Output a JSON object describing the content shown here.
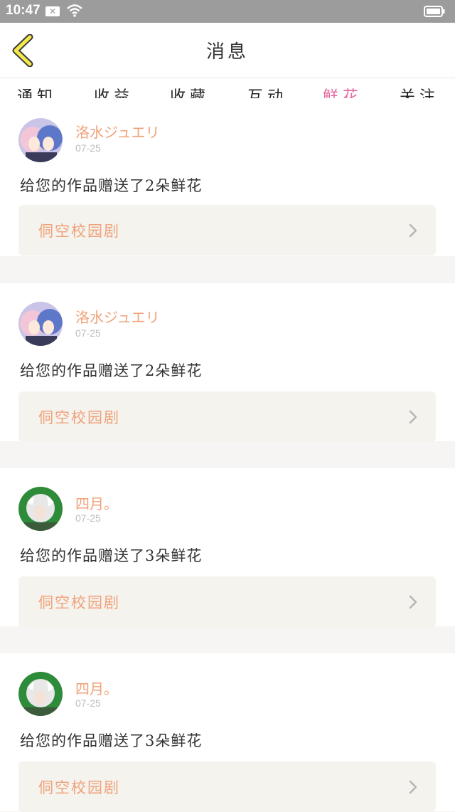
{
  "status_bar": {
    "time": "10:47",
    "icons": [
      "notification-x-icon",
      "wifi-icon",
      "battery-icon"
    ]
  },
  "header": {
    "title": "消息",
    "back_icon": "chevron-left-icon"
  },
  "tabs": [
    {
      "label": "通知",
      "active": false
    },
    {
      "label": "收益",
      "active": false
    },
    {
      "label": "收藏",
      "active": false
    },
    {
      "label": "互动",
      "active": false
    },
    {
      "label": "鲜花",
      "active": true
    },
    {
      "label": "关注",
      "active": false
    }
  ],
  "colors": {
    "accent": "#e56aa2",
    "username": "#f0a27a",
    "link_bg": "#f4f3ee",
    "status_bar": "#9c9c9c"
  },
  "messages": [
    {
      "username": "洛水ジュエリ",
      "date": "07-25",
      "text": "给您的作品赠送了2朵鲜花",
      "work_title": "侗空校园剧",
      "avatar": "anime-girls-avatar"
    },
    {
      "username": "洛水ジュエリ",
      "date": "07-25",
      "text": "给您的作品赠送了2朵鲜花",
      "work_title": "侗空校园剧",
      "avatar": "anime-girls-avatar"
    },
    {
      "username": "四月。",
      "date": "07-25",
      "text": "给您的作品赠送了3朵鲜花",
      "work_title": "侗空校园剧",
      "avatar": "white-hair-character-avatar"
    },
    {
      "username": "四月。",
      "date": "07-25",
      "text": "给您的作品赠送了3朵鲜花",
      "work_title": "侗空校园剧",
      "avatar": "white-hair-character-avatar"
    }
  ]
}
